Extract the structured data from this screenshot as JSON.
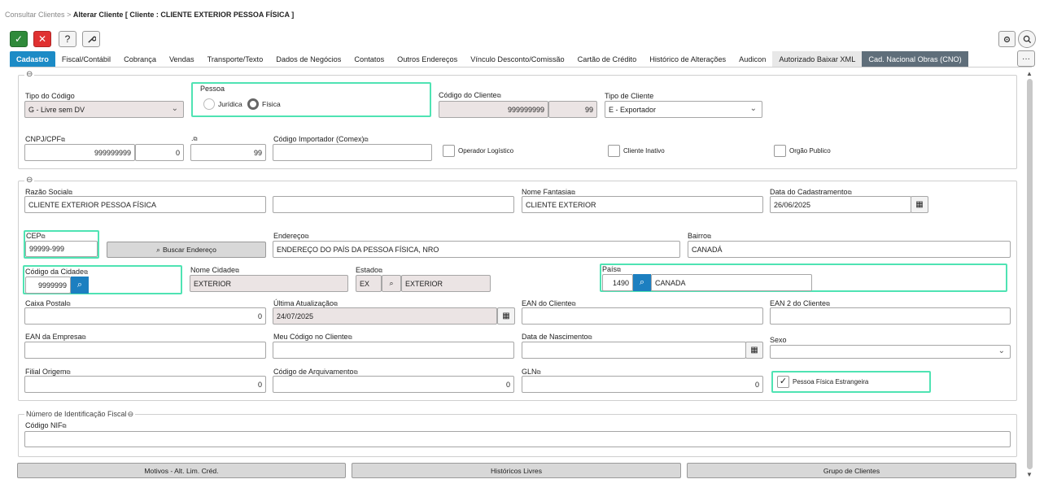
{
  "breadcrumb": {
    "parent": "Consultar Clientes",
    "sep": ">",
    "current": "Alterar Cliente [ Cliente : CLIENTE EXTERIOR PESSOA FÍSICA ]"
  },
  "toolbar": {
    "confirm": "✓",
    "cancel": "✕",
    "help": "?",
    "tools": "🔧"
  },
  "tabs": [
    "Cadastro",
    "Fiscal/Contábil",
    "Cobrança",
    "Vendas",
    "Transporte/Texto",
    "Dados de Negócios",
    "Contatos",
    "Outros Endereços",
    "Vínculo Desconto/Comissão",
    "Cartão de Crédito",
    "Histórico de Alterações",
    "Audicon",
    "Autorizado Baixar XML",
    "Cad. Nacional Obras (CNO)"
  ],
  "more_button": "···",
  "section1": {
    "tipo_codigo_label": "Tipo do Código",
    "tipo_codigo_value": "G - Livre sem DV",
    "pessoa_label": "Pessoa",
    "juridica": "Jurídica",
    "fisica": "Física",
    "codigo_cliente_label": "Código do Cliente",
    "codigo_cliente": "999999999",
    "codigo_cliente_dv": "99",
    "tipo_cliente_label": "Tipo de Cliente",
    "tipo_cliente_value": "E - Exportador",
    "cnpj_label": "CNPJ/CPF",
    "cnpj_value": "999999999",
    "cnpj_dv": "0",
    "dot_label": ".",
    "dot_value": "99",
    "cod_importador_label": "Código Importador (Comex)",
    "cod_importador_value": "",
    "operador_logistico": "Operador Logístico",
    "cliente_inativo": "Cliente Inativo",
    "orgao_publico": "Orgão Publico"
  },
  "section2": {
    "razao_social_label": "Razão Social",
    "razao_social": "CLIENTE EXTERIOR PESSOA FÍSICA",
    "razao_social_2": "",
    "nome_fantasia_label": "Nome Fantasia",
    "nome_fantasia": "CLIENTE EXTERIOR",
    "data_cadastro_label": "Data do Cadastramento",
    "data_cadastro": "26/06/2025",
    "cep_label": "CEP",
    "cep": "99999-999",
    "buscar_endereco": "Buscar Endereço",
    "endereco_label": "Endereço",
    "endereco": "ENDEREÇO DO PAÍS DA PESSOA FÍSICA, NRO",
    "bairro_label": "Bairro",
    "bairro": "CANADÁ",
    "cod_cidade_label": "Código da Cidade",
    "cod_cidade": "9999999",
    "nome_cidade_label": "Nome Cidade",
    "nome_cidade": "EXTERIOR",
    "estado_label": "Estado",
    "estado_uf": "EX",
    "estado_nome": "EXTERIOR",
    "pais_label": "País",
    "pais_cod": "1490",
    "pais_nome": "CANADA",
    "caixa_postal_label": "Caixa Postal",
    "caixa_postal": "0",
    "ultima_atualizacao_label": "Última Atualização",
    "ultima_atualizacao": "24/07/2025",
    "ean_cliente_label": "EAN do Cliente",
    "ean2_cliente_label": "EAN 2 do Cliente",
    "ean_empresa_label": "EAN da Empresa",
    "meu_codigo_label": "Meu Código no Cliente",
    "data_nascimento_label": "Data de Nascimento",
    "sexo_label": "Sexo",
    "filial_origem_label": "Filial Origem",
    "filial_origem": "0",
    "cod_arquivamento_label": "Código de Arquivamento",
    "cod_arquivamento": "0",
    "gln_label": "GLN",
    "gln": "0",
    "pf_estrangeira": "Pessoa Física Estrangeira"
  },
  "section3": {
    "title": "Número de Identificação Fiscal",
    "nif_label": "Código NIF",
    "nif": ""
  },
  "bottom_buttons": {
    "motivos": "Motivos - Alt. Lim. Créd.",
    "historicos": "Históricos Livres",
    "grupo": "Grupo de Clientes"
  },
  "colors": {
    "accent": "#1c8bc6",
    "highlight": "#4fe3b3",
    "confirm": "#2f8a3a",
    "cancel": "#e03131"
  }
}
